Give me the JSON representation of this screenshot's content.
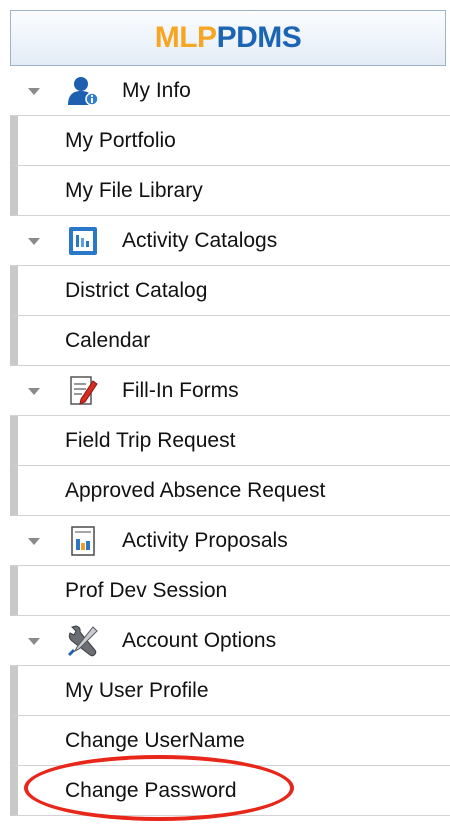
{
  "logo": {
    "part1": "MLP",
    "part2": "PDMS"
  },
  "groups": [
    {
      "label": "My Info",
      "icon": "user-info-icon",
      "items": [
        "My Portfolio",
        "My File Library"
      ]
    },
    {
      "label": "Activity Catalogs",
      "icon": "catalog-icon",
      "items": [
        "District Catalog",
        "Calendar"
      ]
    },
    {
      "label": "Fill-In Forms",
      "icon": "form-edit-icon",
      "items": [
        "Field Trip Request",
        "Approved Absence Request"
      ]
    },
    {
      "label": "Activity Proposals",
      "icon": "proposal-icon",
      "items": [
        "Prof Dev Session"
      ]
    },
    {
      "label": "Account Options",
      "icon": "wrench-screwdriver-icon",
      "items": [
        "My User Profile",
        "Change UserName",
        "Change Password"
      ]
    }
  ],
  "colors": {
    "logo_orange": "#f5a623",
    "logo_blue": "#1c64b4",
    "highlight_red": "#e8261a"
  }
}
